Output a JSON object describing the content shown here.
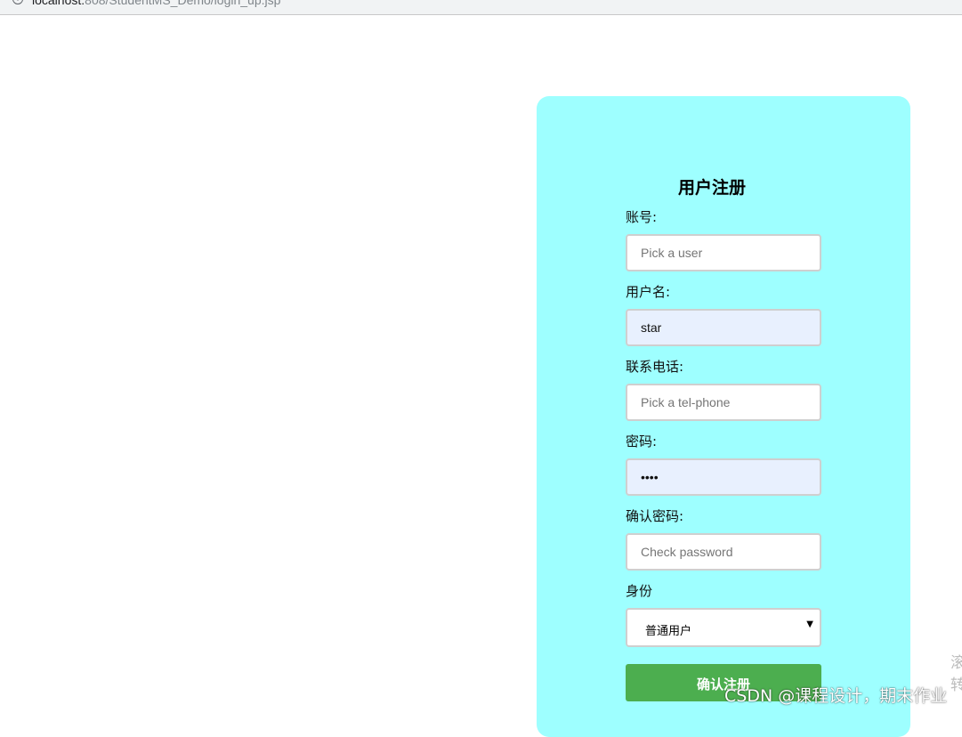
{
  "browser": {
    "url_host": "localhost:",
    "url_path": "808/StudentMS_Demo/login_up.jsp",
    "info_icon": "info-icon"
  },
  "form": {
    "title": "用户注册",
    "account_label": "账号:",
    "account_placeholder": "Pick a user",
    "account_value": "",
    "username_label": "用户名:",
    "username_value": "star",
    "phone_label": "联系电话:",
    "phone_placeholder": "Pick a tel-phone",
    "phone_value": "",
    "password_label": "密码:",
    "password_value": "1234",
    "confirm_label": "确认密码:",
    "confirm_placeholder": "Check password",
    "confirm_value": "",
    "role_label": "身份",
    "role_selected": "普通用户",
    "role_arrow": "▼",
    "submit_label": "确认注册"
  },
  "overlay": {
    "watermark": "CSDN @课程设计，期末作业",
    "side_char_1": "滚",
    "side_char_2": "转"
  },
  "colors": {
    "card_background": "#9effff",
    "submit_background": "#4cae4f",
    "autofill_background": "#e8f0fe"
  }
}
